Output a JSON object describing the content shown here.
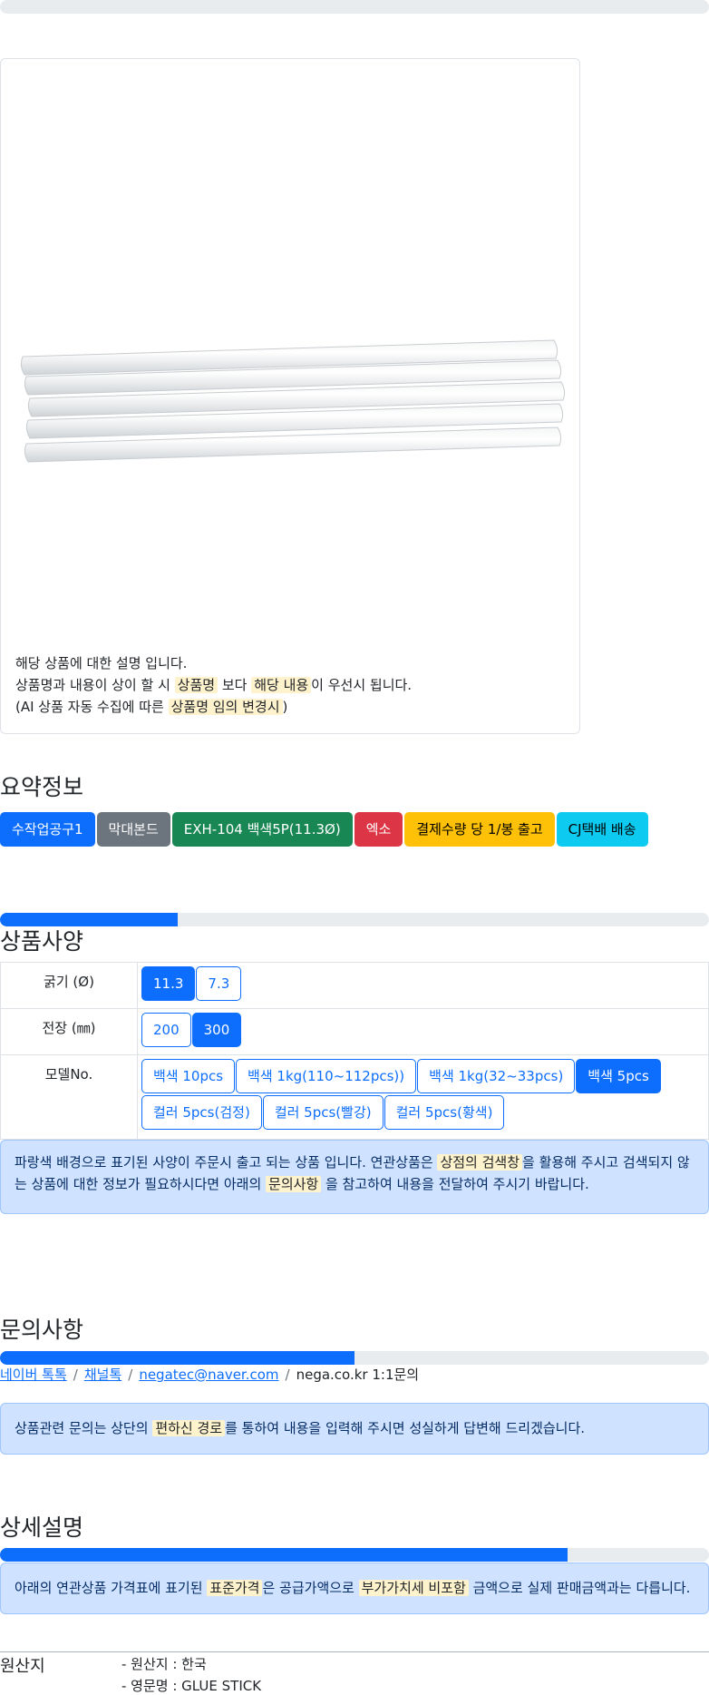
{
  "photo_notice": {
    "line1": "해당 상품에 대한 설명 입니다.",
    "line2_a": "상품명과 내용이 상이 할 시 ",
    "line2_m1": "상품명",
    "line2_b": " 보다 ",
    "line2_m2": "해당 내용",
    "line2_c": "이 우선시 됩니다.",
    "line3_a": "(AI 상품 자동 수집에 따른 ",
    "line3_m": "상품명 임의 변경시",
    "line3_b": ")"
  },
  "summary": {
    "title": "요약정보",
    "badges": [
      "수작업공구1",
      "막대본드",
      "EXH-104 백색5P(11.3Ø)",
      "엑소",
      "결제수량 당 1/봉 출고",
      "CJ택배 배송"
    ]
  },
  "progress": {
    "top": 0.0,
    "spec": 0.25,
    "inquiry": 0.5,
    "detail": 0.8
  },
  "spec": {
    "title": "상품사양",
    "rows": [
      {
        "label": "굵기 (Ø)",
        "options": [
          "11.3",
          "7.3"
        ],
        "selected": "11.3"
      },
      {
        "label": "전장 (㎜)",
        "options": [
          "200",
          "300"
        ],
        "selected": "300"
      },
      {
        "label": "모델No.",
        "options": [
          "백색 10pcs",
          "백색 1kg(110~112pcs))",
          "백색 1kg(32~33pcs)",
          "백색 5pcs",
          "컬러 5pcs(검정)",
          "컬러 5pcs(빨강)",
          "컬러 5pcs(황색)"
        ],
        "selected": "백색 5pcs"
      }
    ],
    "notice_a": "파랑색 배경으로 표기된 사양이 주문시 출고 되는 상품 입니다. 연관상품은 ",
    "notice_m1": "상점의 검색창",
    "notice_b": "을 활용해 주시고 검색되지 않는 상품에 대한 정보가 필요하시다면 아래의 ",
    "notice_m2": "문의사항",
    "notice_c": " 을 참고하여 내용을 전달하여 주시기 바랍니다."
  },
  "inquiry": {
    "title": "문의사항",
    "links": [
      "네이버 톡톡",
      "채널톡",
      "negatec@naver.com"
    ],
    "plain": "nega.co.kr 1:1문의",
    "separator": "/",
    "notice_a": "상품관련 문의는 상단의 ",
    "notice_m": "편하신 경로",
    "notice_b": "를 통하여 내용을 입력해 주시면 성실하게 답변해 드리겠습니다."
  },
  "detail": {
    "title": "상세설명",
    "notice_a": "아래의 연관상품 가격표에 표기된 ",
    "notice_m1": "표준가격",
    "notice_b": "은 공급가액으로 ",
    "notice_m2": "부가가치세 비포함",
    "notice_c": " 금액으로 실제 판매금액과는 다릅니다."
  },
  "origin": {
    "title": "원산지",
    "items": [
      "- 원산지 : 한국",
      "- 영문명 : GLUE STICK"
    ]
  }
}
